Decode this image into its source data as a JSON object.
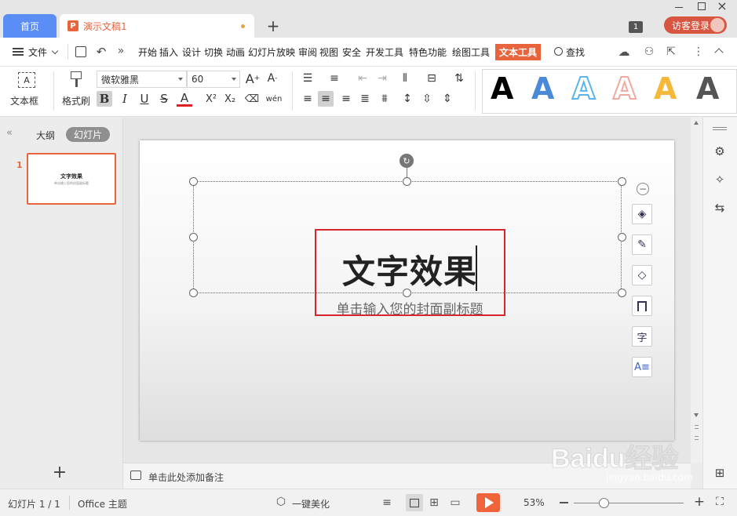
{
  "tabs": {
    "home": "首页",
    "document": "演示文稿1"
  },
  "window": {
    "badge_count": "1",
    "login_label": "访客登录"
  },
  "menu": {
    "file": "文件",
    "items": [
      "开始",
      "插入",
      "设计",
      "切换",
      "动画",
      "幻灯片放映",
      "审阅",
      "视图",
      "安全",
      "开发工具",
      "特色功能",
      "绘图工具",
      "文本工具"
    ],
    "active_item": "文本工具",
    "search": "查找"
  },
  "ribbon": {
    "textbox_label": "文本框",
    "format_painter_label": "格式刷",
    "font_name": "微软雅黑",
    "font_size": "60",
    "bold": "B",
    "italic": "I",
    "underline": "U",
    "strike": "S",
    "font_color": "A",
    "superscript": "X²",
    "subscript": "X₂",
    "phonetic": "wén",
    "style_letter": "A",
    "style_colors": [
      "#000000",
      "#4a8ad8",
      "#5cb5e8",
      "#f2a9a0",
      "#f4b83a",
      "#555555"
    ]
  },
  "panel": {
    "outline_tab": "大纲",
    "slides_tab": "幻灯片",
    "slide_number": "1",
    "thumb_title": "文字效果",
    "thumb_subtitle": "单击输入您的封面副标题"
  },
  "slide": {
    "title": "文字效果",
    "subtitle": "单击输入您的封面副标题",
    "highlight_color": "#d9242b"
  },
  "notes": {
    "placeholder": "单击此处添加备注"
  },
  "status": {
    "slide_info": "幻灯片 1 / 1",
    "theme": "Office 主题",
    "beautify": "一键美化",
    "zoom": "53%"
  },
  "watermark": {
    "brand": "Baidu经验",
    "url": "jingyan.baidu.com"
  },
  "colors": {
    "accent": "#e8643c",
    "home_tab": "#5b8df6",
    "login": "#d8553f",
    "play": "#f0643c"
  }
}
